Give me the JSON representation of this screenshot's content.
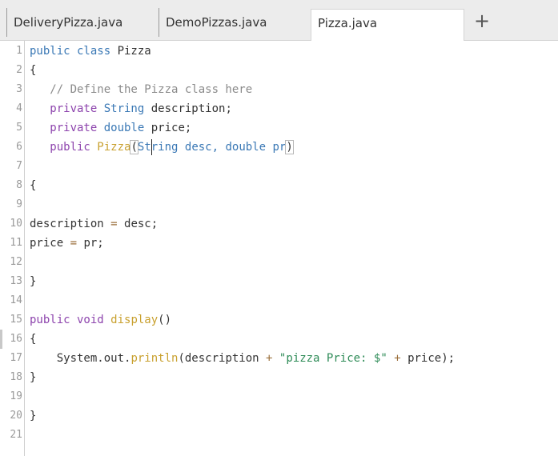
{
  "tabs": {
    "tab1": "DeliveryPizza.java",
    "tab2": "DemoPizzas.java",
    "active": "Pizza.java",
    "add_label": "+"
  },
  "gutter": {
    "modified_lines": [
      16
    ]
  },
  "lines": [
    {
      "n": "1",
      "segments": [
        {
          "t": "public class ",
          "c": "kw"
        },
        {
          "t": "Pizza",
          "c": "plain"
        }
      ]
    },
    {
      "n": "2",
      "segments": [
        {
          "t": "{",
          "c": "plain"
        }
      ]
    },
    {
      "n": "3",
      "segments": [
        {
          "t": "   // Define the Pizza class here",
          "c": "cm"
        }
      ]
    },
    {
      "n": "4",
      "segments": [
        {
          "t": "   private ",
          "c": "kw2"
        },
        {
          "t": "String ",
          "c": "kw"
        },
        {
          "t": "description;",
          "c": "plain"
        }
      ]
    },
    {
      "n": "5",
      "segments": [
        {
          "t": "   private ",
          "c": "kw2"
        },
        {
          "t": "double ",
          "c": "kw"
        },
        {
          "t": "price;",
          "c": "plain"
        }
      ]
    },
    {
      "n": "6",
      "segments": [
        {
          "t": "   public ",
          "c": "kw2"
        },
        {
          "t": "Pizza",
          "c": "fn"
        },
        {
          "t": "(",
          "c": "plain",
          "hl": true
        },
        {
          "t": "String desc, ",
          "c": "kw"
        },
        {
          "t": "double ",
          "c": "kw"
        },
        {
          "t": "pr",
          "c": "kw"
        },
        {
          "t": ")",
          "c": "plain",
          "hl": true
        }
      ]
    },
    {
      "n": "7",
      "segments": []
    },
    {
      "n": "8",
      "segments": [
        {
          "t": "{",
          "c": "plain"
        }
      ]
    },
    {
      "n": "9",
      "segments": []
    },
    {
      "n": "10",
      "segments": [
        {
          "t": "description ",
          "c": "plain"
        },
        {
          "t": "=",
          "c": "op"
        },
        {
          "t": " desc;",
          "c": "plain"
        }
      ]
    },
    {
      "n": "11",
      "segments": [
        {
          "t": "price ",
          "c": "plain"
        },
        {
          "t": "=",
          "c": "op"
        },
        {
          "t": " pr;",
          "c": "plain"
        }
      ]
    },
    {
      "n": "12",
      "segments": []
    },
    {
      "n": "13",
      "segments": [
        {
          "t": "}",
          "c": "plain"
        }
      ]
    },
    {
      "n": "14",
      "segments": []
    },
    {
      "n": "15",
      "segments": [
        {
          "t": "public void ",
          "c": "kw2"
        },
        {
          "t": "display",
          "c": "fn"
        },
        {
          "t": "()",
          "c": "plain"
        }
      ]
    },
    {
      "n": "16",
      "segments": [
        {
          "t": "{",
          "c": "plain"
        }
      ]
    },
    {
      "n": "17",
      "segments": [
        {
          "t": "    System.out.",
          "c": "plain"
        },
        {
          "t": "println",
          "c": "fn"
        },
        {
          "t": "(description ",
          "c": "plain"
        },
        {
          "t": "+",
          "c": "op"
        },
        {
          "t": " ",
          "c": "plain"
        },
        {
          "t": "\"pizza Price: $\"",
          "c": "str"
        },
        {
          "t": " ",
          "c": "plain"
        },
        {
          "t": "+",
          "c": "op"
        },
        {
          "t": " price);",
          "c": "plain"
        }
      ]
    },
    {
      "n": "18",
      "segments": [
        {
          "t": "}",
          "c": "plain"
        }
      ]
    },
    {
      "n": "19",
      "segments": []
    },
    {
      "n": "20",
      "segments": [
        {
          "t": "}",
          "c": "plain"
        }
      ]
    },
    {
      "n": "21",
      "segments": []
    }
  ],
  "cursor": {
    "line": 6
  }
}
